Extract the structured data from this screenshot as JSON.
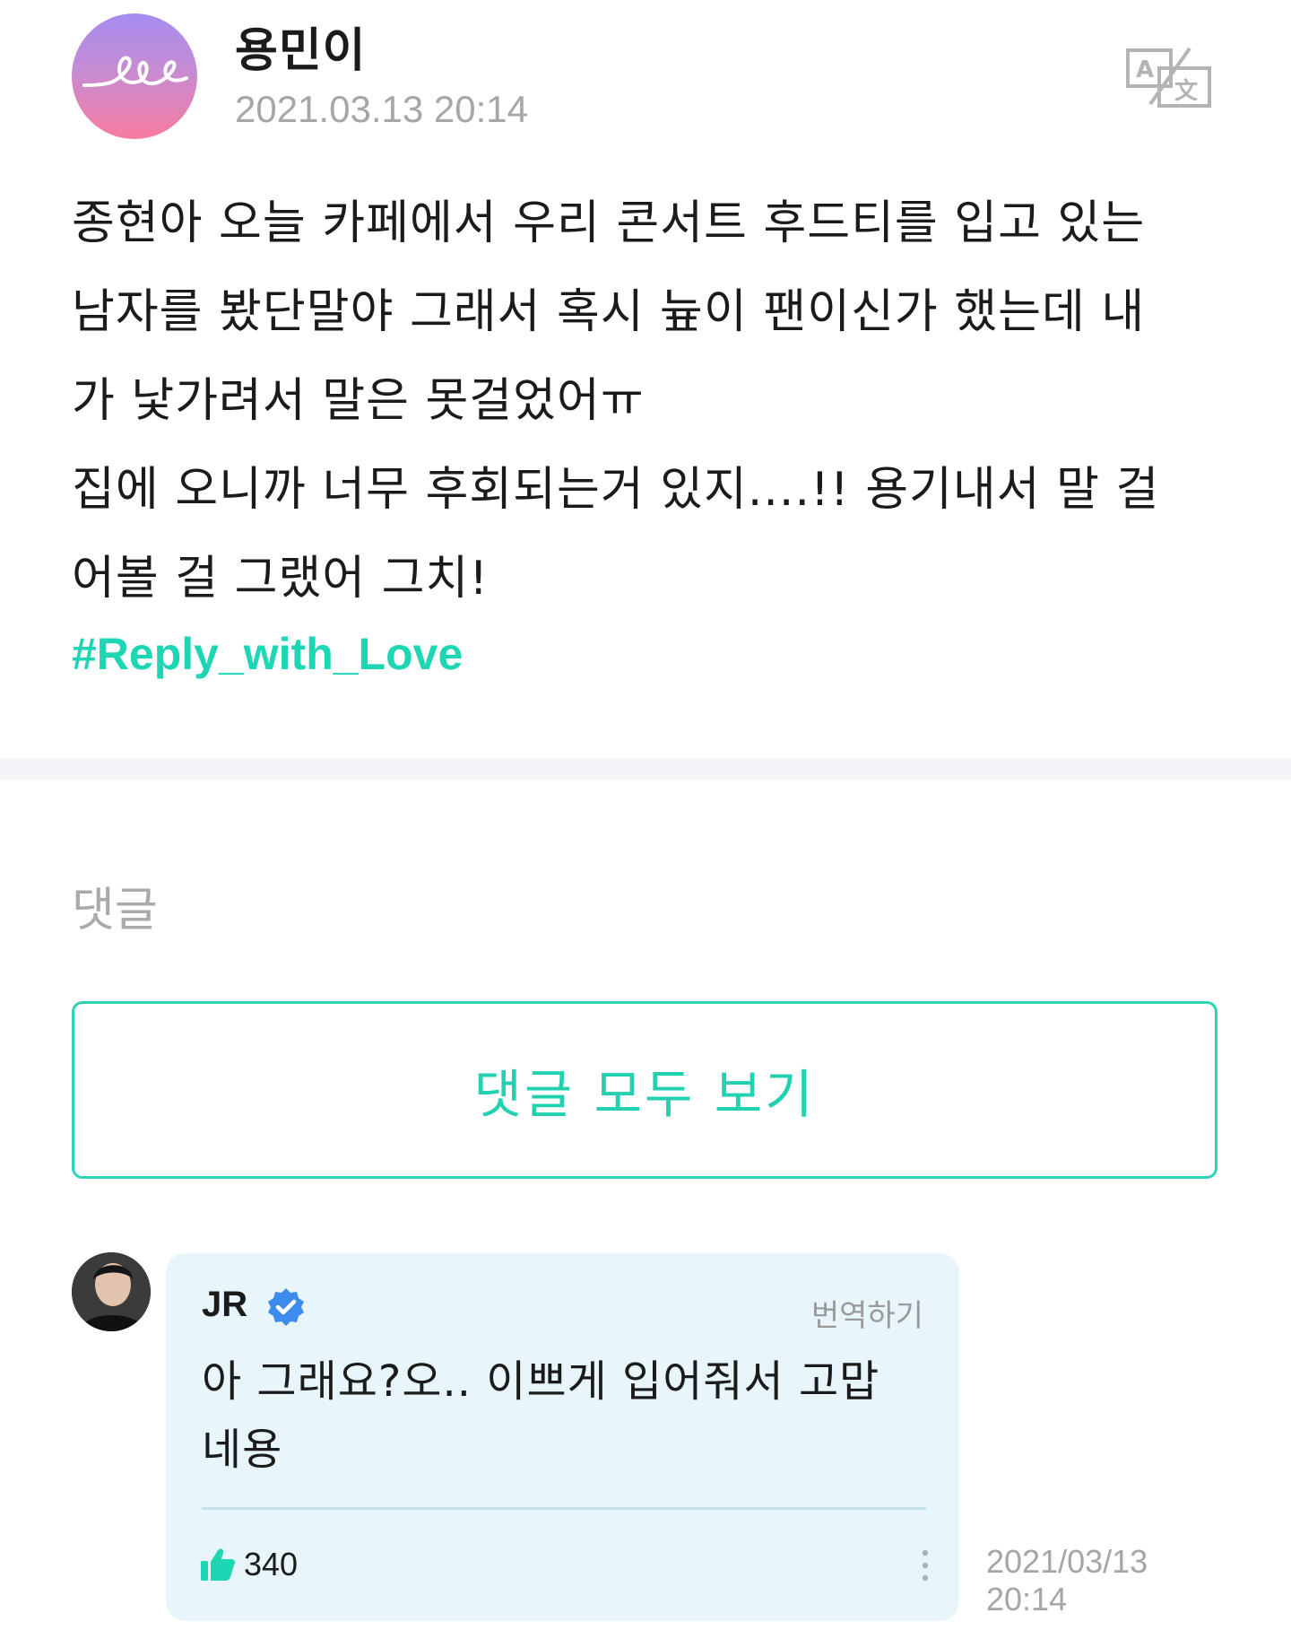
{
  "post": {
    "author": "용민이",
    "date": "2021.03.13 20:14",
    "body": "종현아 오늘 카페에서 우리 콘서트 후드티를 입고 있는\n남자를 봤단말야 그래서 혹시 늎이 팬이신가 했는데 내\n가 낯가려서 말은 못걸었어ㅠ\n집에 오니까 너무 후회되는거 있지....!! 용기내서 말 걸\n어볼 걸 그랬어 그치!",
    "hashtag": "#Reply_with_Love",
    "translate_icon": "translate-icon",
    "avatar_colors": [
      "#a58cf0",
      "#f77ba0"
    ]
  },
  "comments": {
    "label": "댓글",
    "view_all_label": "댓글 모두 보기",
    "accent_color": "#2ed3b6",
    "items": [
      {
        "author": "JR",
        "verified_icon": "verified-badge-icon",
        "translate_label": "번역하기",
        "text": "아 그래요?오.. 이쁘게 입어줘서 고맙\n네용",
        "likes": "340",
        "date": "2021/03/13\n20:14"
      }
    ]
  }
}
